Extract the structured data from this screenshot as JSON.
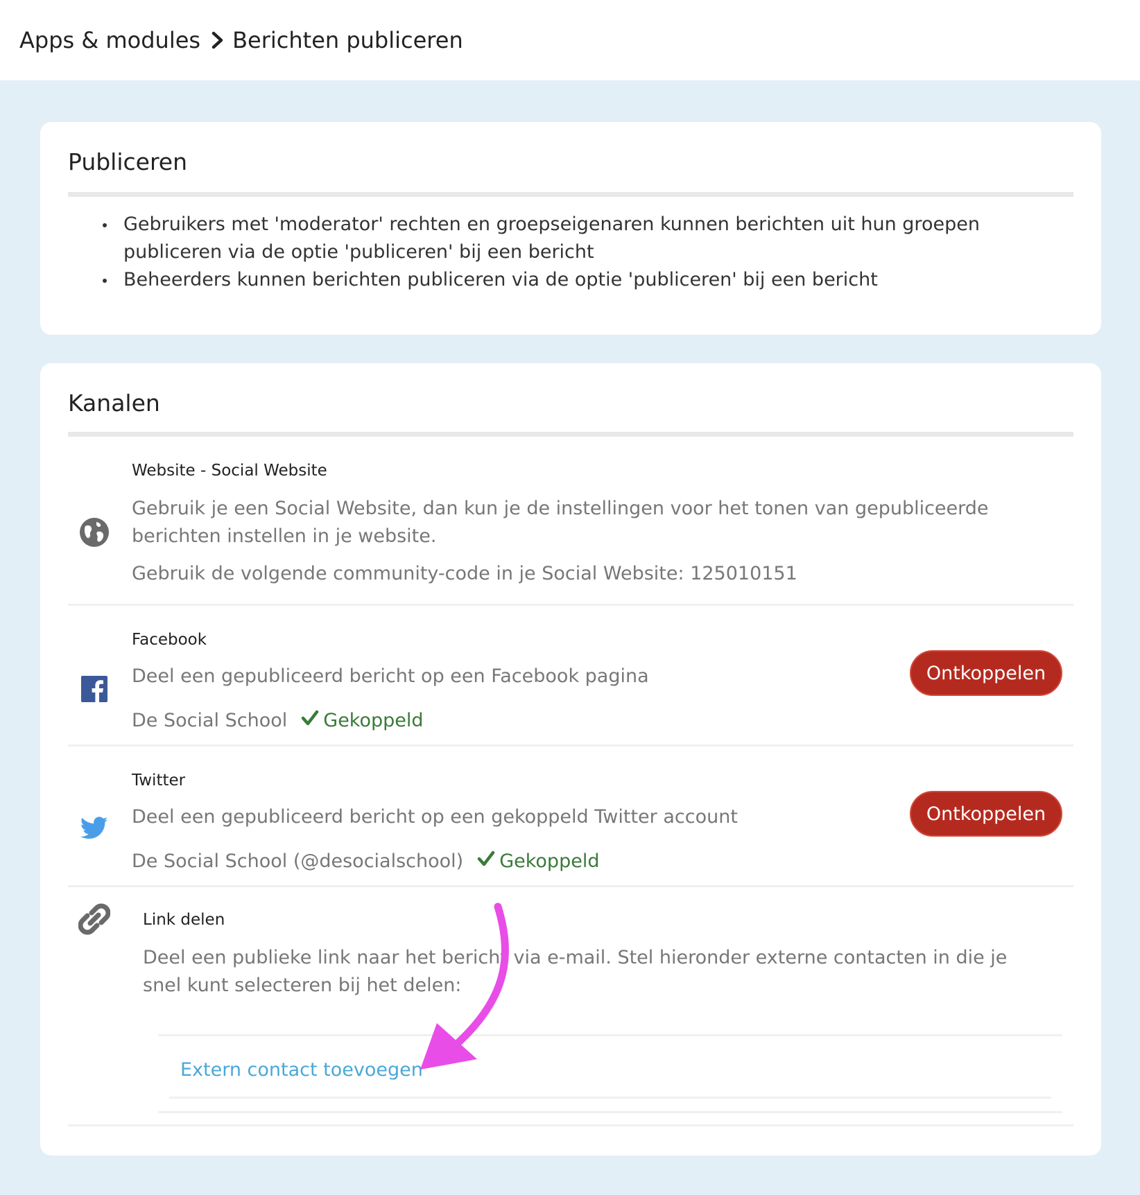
{
  "breadcrumb": {
    "parent": "Apps & modules",
    "current": "Berichten publiceren"
  },
  "publiceren": {
    "title": "Publiceren",
    "bullets": [
      "Gebruikers met 'moderator' rechten en groepseigenaren kunnen berichten uit hun groepen publiceren via de optie 'publiceren' bij een bericht",
      "Beheerders kunnen berichten publiceren via de optie 'publiceren' bij een bericht"
    ]
  },
  "kanalen": {
    "title": "Kanalen",
    "website": {
      "name": "Website - Social Website",
      "desc": "Gebruik je een Social Website, dan kun je de instellingen voor het tonen van gepubliceerde berichten instellen in je website.",
      "code_line": "Gebruik de volgende community-code in je Social Website: 125010151",
      "icon": "globe-icon"
    },
    "facebook": {
      "name": "Facebook",
      "desc": "Deel een gepubliceerd bericht op een Facebook pagina",
      "account": "De Social School",
      "status": "Gekoppeld",
      "button": "Ontkoppelen",
      "icon": "facebook-icon"
    },
    "twitter": {
      "name": "Twitter",
      "desc": "Deel een gepubliceerd bericht op een gekoppeld Twitter account",
      "account": "De Social School (@desocialschool)",
      "status": "Gekoppeld",
      "button": "Ontkoppelen",
      "icon": "twitter-icon"
    },
    "link": {
      "name": "Link delen",
      "desc": "Deel een publieke link naar het bericht via e-mail. Stel hieronder externe contacten in die je snel kunt selecteren bij het delen:",
      "add_contact": "Extern contact toevoegen",
      "icon": "link-icon"
    }
  },
  "colors": {
    "background": "#e3eff6",
    "disconnect_button": "#b52a1f",
    "connected_status": "#3a7a3a",
    "link": "#4aa8d8",
    "annotation_arrow": "#e84de8"
  }
}
